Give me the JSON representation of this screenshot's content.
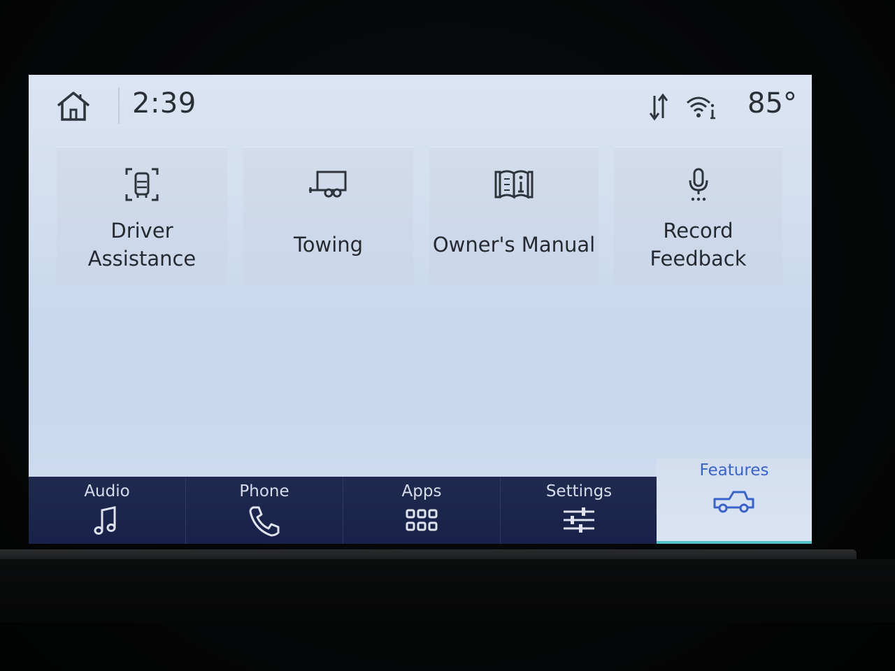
{
  "status_bar": {
    "time": "2:39",
    "temperature": "85°",
    "icons": [
      "home-icon",
      "data-transfer-icon",
      "wifi-info-icon"
    ]
  },
  "tiles": [
    {
      "label": "Driver\nAssistance",
      "icon": "driver-assist-icon"
    },
    {
      "label": "Towing",
      "icon": "trailer-icon"
    },
    {
      "label": "Owner's Manual",
      "icon": "manual-book-icon"
    },
    {
      "label": "Record\nFeedback",
      "icon": "microphone-icon"
    }
  ],
  "nav": {
    "items": [
      {
        "label": "Audio",
        "icon": "music-note-icon"
      },
      {
        "label": "Phone",
        "icon": "phone-icon"
      },
      {
        "label": "Apps",
        "icon": "apps-grid-icon"
      },
      {
        "label": "Settings",
        "icon": "sliders-icon"
      }
    ],
    "active": {
      "label": "Features",
      "icon": "truck-icon"
    }
  },
  "colors": {
    "screen_bg": "#d2deef",
    "nav_bg": "#1c2650",
    "accent": "#3a63c8",
    "active_indicator": "#4fc3c9"
  }
}
